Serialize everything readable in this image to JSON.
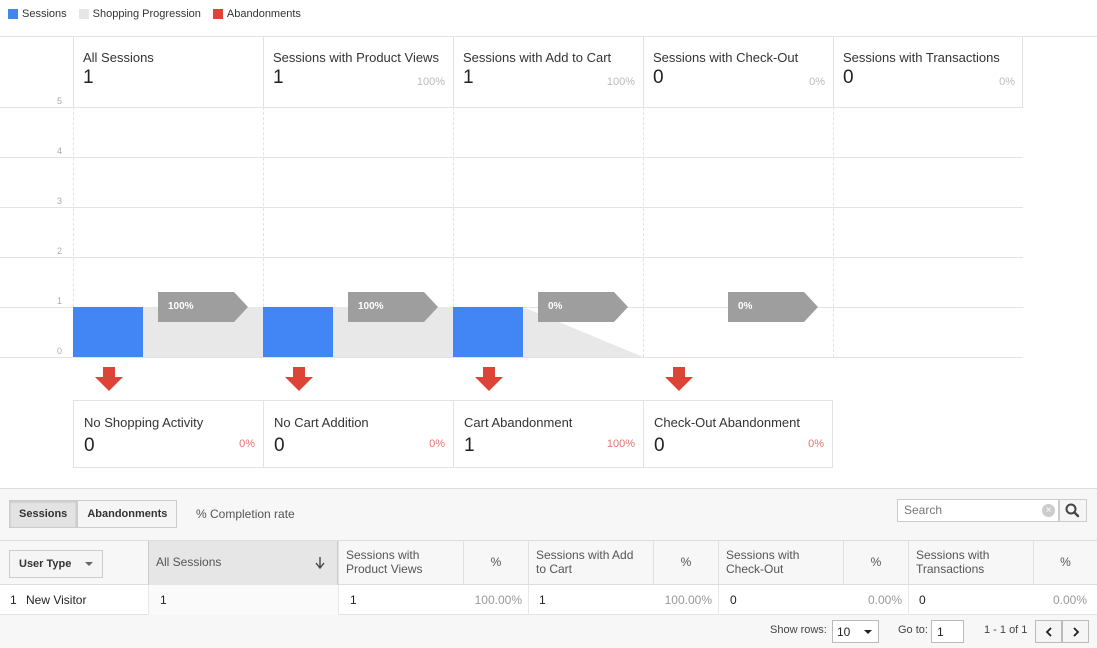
{
  "legend": [
    {
      "label": "Sessions",
      "color": "#4285f4"
    },
    {
      "label": "Shopping Progression",
      "color": "#e6e6e6"
    },
    {
      "label": "Abandonments",
      "color": "#db4437"
    }
  ],
  "chart_data": {
    "type": "bar",
    "categories": [
      "All Sessions",
      "Sessions with Product Views",
      "Sessions with Add to Cart",
      "Sessions with Check-Out",
      "Sessions with Transactions"
    ],
    "series": [
      {
        "name": "Sessions",
        "values": [
          1,
          1,
          1,
          0,
          0
        ]
      },
      {
        "name": "Abandonments",
        "values": [
          0,
          0,
          1,
          0
        ]
      }
    ],
    "yticks": [
      "0",
      "1",
      "2",
      "3",
      "4",
      "5"
    ],
    "ylim": [
      0,
      5
    ]
  },
  "stages": [
    {
      "title": "All Sessions",
      "value": "1",
      "pct": ""
    },
    {
      "title": "Sessions with Product Views",
      "value": "1",
      "pct": "100%"
    },
    {
      "title": "Sessions with Add to Cart",
      "value": "1",
      "pct": "100%"
    },
    {
      "title": "Sessions with Check-Out",
      "value": "0",
      "pct": "0%"
    },
    {
      "title": "Sessions with Transactions",
      "value": "0",
      "pct": "0%"
    }
  ],
  "progression": [
    {
      "label": "100%"
    },
    {
      "label": "100%"
    },
    {
      "label": "0%"
    },
    {
      "label": "0%"
    }
  ],
  "abandonments": [
    {
      "title": "No Shopping Activity",
      "value": "0",
      "pct": "0%"
    },
    {
      "title": "No Cart Addition",
      "value": "0",
      "pct": "0%"
    },
    {
      "title": "Cart Abandonment",
      "value": "1",
      "pct": "100%"
    },
    {
      "title": "Check-Out Abandonment",
      "value": "0",
      "pct": "0%"
    }
  ],
  "table": {
    "tabs": [
      "Sessions",
      "Abandonments"
    ],
    "completion_label": "% Completion rate",
    "search_placeholder": "Search",
    "dimension_button": "User Type",
    "headers": {
      "all_sessions": "All Sessions",
      "product_views": "Sessions with Product Views",
      "add_to_cart": "Sessions with Add to Cart",
      "check_out": "Sessions with Check-Out",
      "transactions": "Sessions with Transactions",
      "pct": "%"
    },
    "row": {
      "index": "1",
      "user_type": "New Visitor",
      "all_sessions": "1",
      "product_views": "1",
      "product_views_pct": "100.00%",
      "add_to_cart": "1",
      "add_to_cart_pct": "100.00%",
      "check_out": "0",
      "check_out_pct": "0.00%",
      "transactions": "0",
      "transactions_pct": "0.00%"
    },
    "pager": {
      "show_rows_label": "Show rows:",
      "show_rows_value": "10",
      "goto_label": "Go to:",
      "goto_value": "1",
      "range": "1 - 1 of 1"
    }
  }
}
